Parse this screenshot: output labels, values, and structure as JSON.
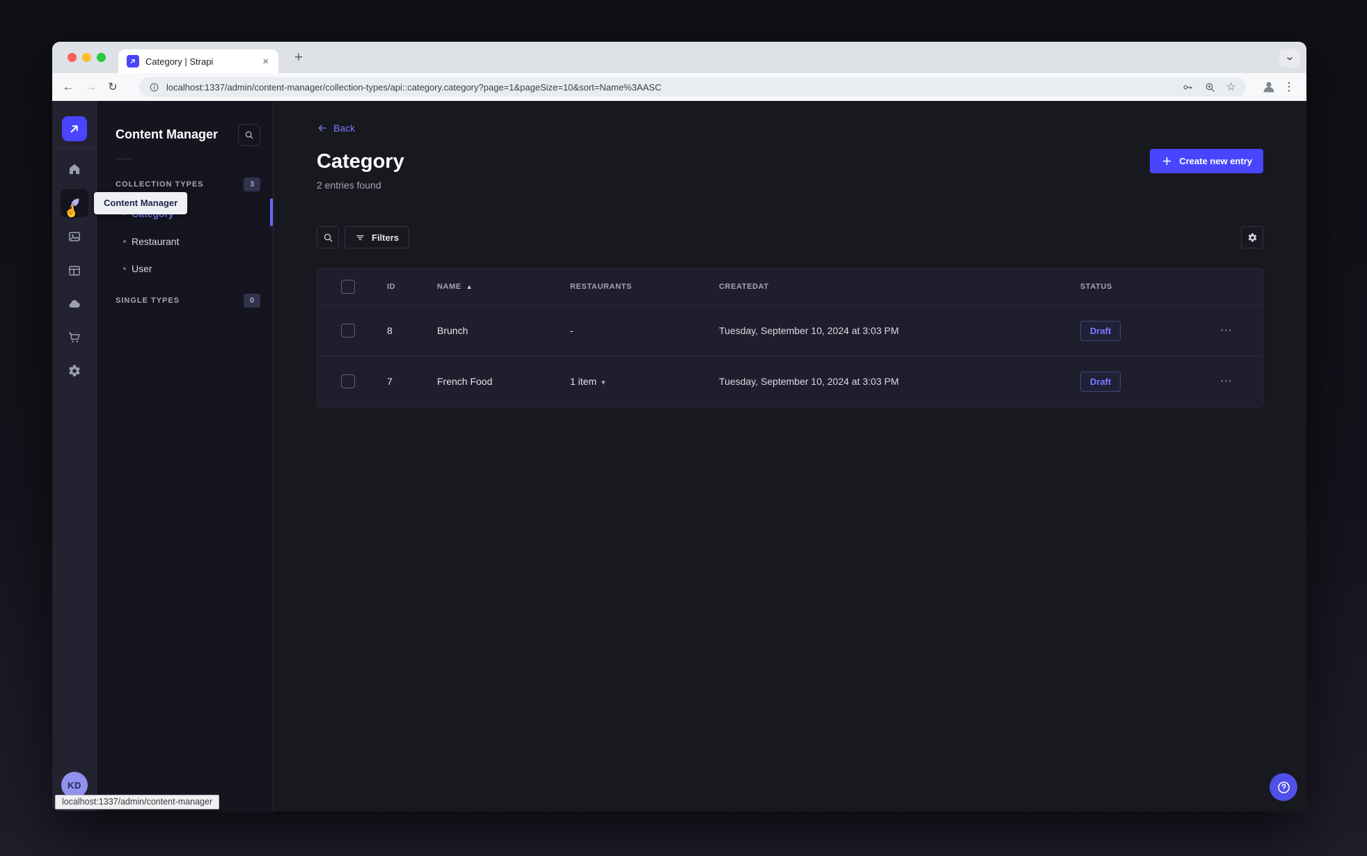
{
  "browser": {
    "tab_title": "Category | Strapi",
    "url": "localhost:1337/admin/content-manager/collection-types/api::category.category?page=1&pageSize=10&sort=Name%3AASC",
    "status_link": "localhost:1337/admin/content-manager"
  },
  "sidebar": {
    "tooltip": "Content Manager",
    "avatar_initials": "KD"
  },
  "subnav": {
    "title": "Content Manager",
    "sections": [
      {
        "label": "COLLECTION TYPES",
        "badge": "3"
      },
      {
        "label": "SINGLE TYPES",
        "badge": "0"
      }
    ],
    "items": [
      {
        "label": "Category",
        "active": true
      },
      {
        "label": "Restaurant",
        "active": false
      },
      {
        "label": "User",
        "active": false
      }
    ]
  },
  "main": {
    "back_label": "Back",
    "title": "Category",
    "subtitle": "2 entries found",
    "create_button": "Create new entry",
    "filters_button": "Filters",
    "table": {
      "headers": [
        "ID",
        "NAME",
        "RESTAURANTS",
        "CREATEDAT",
        "STATUS"
      ],
      "sorted_by": "NAME",
      "sort_direction": "asc",
      "rows": [
        {
          "id": "8",
          "name": "Brunch",
          "restaurants": "-",
          "created_at": "Tuesday, September 10, 2024 at 3:03 PM",
          "status": "Draft"
        },
        {
          "id": "7",
          "name": "French Food",
          "restaurants": "1 item",
          "created_at": "Tuesday, September 10, 2024 at 3:03 PM",
          "status": "Draft"
        }
      ]
    }
  },
  "glyphs": {
    "sort_asc": "▲",
    "caret_down": "▾",
    "ellipsis": "⋯",
    "tab_close": "×",
    "new_tab": "+",
    "back_arrow": "←",
    "forward_arrow": "→",
    "reload": "↻",
    "star": "☆",
    "menu_dots": "⋮",
    "hand_cursor": "☝"
  },
  "colors": {
    "accent": "#4945ff",
    "accent_light": "#7b79ff",
    "status_draft": "#7b79ff"
  }
}
